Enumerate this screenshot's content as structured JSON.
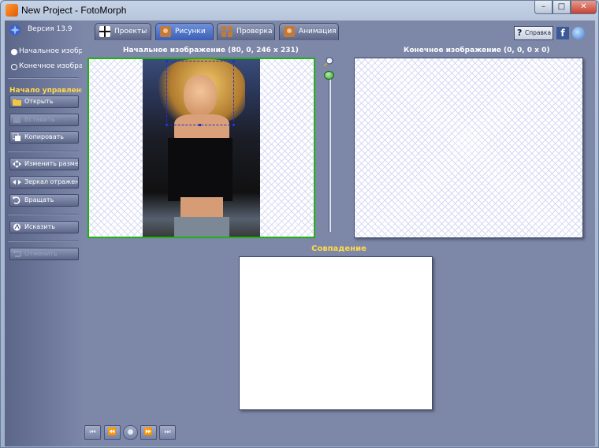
{
  "window": {
    "title": "New Project - FotoMorph",
    "controls": {
      "minimize": "–",
      "maximize": "□",
      "close": "✕"
    }
  },
  "sidebar": {
    "version": "Версия 13.9",
    "source_option": "Начальное изображ.",
    "target_option": "Конечное изображ.",
    "selected_option": "source",
    "section_title": "Начало управления",
    "buttons": {
      "open": "Открыть",
      "paste": "Вставить",
      "copy": "Копировать",
      "resize": "Изменить размер",
      "mirror": "Зеркал отражение",
      "rotate": "Вращать",
      "distort": "Исказить",
      "undo": "Отменить"
    }
  },
  "tabs": {
    "projects": "Проекты",
    "pictures": "Рисунки",
    "check": "Проверка",
    "animation": "Анимация",
    "active": "pictures"
  },
  "header": {
    "help": "Справка",
    "facebook": "f"
  },
  "workarea": {
    "source_caption": "Начальное изображение (80, 0, 246 x 231)",
    "target_caption": "Конечное изображение (0, 0, 0 x 0)",
    "match_label": "Совпадение"
  },
  "playback": {
    "first": "⏮",
    "prev": "⏪",
    "play": "●",
    "next": "⏩",
    "last": "⏭"
  },
  "colors": {
    "accent_yellow": "#ffd94a",
    "active_tab": "#3b5fb5",
    "selection_border": "#22b014"
  }
}
